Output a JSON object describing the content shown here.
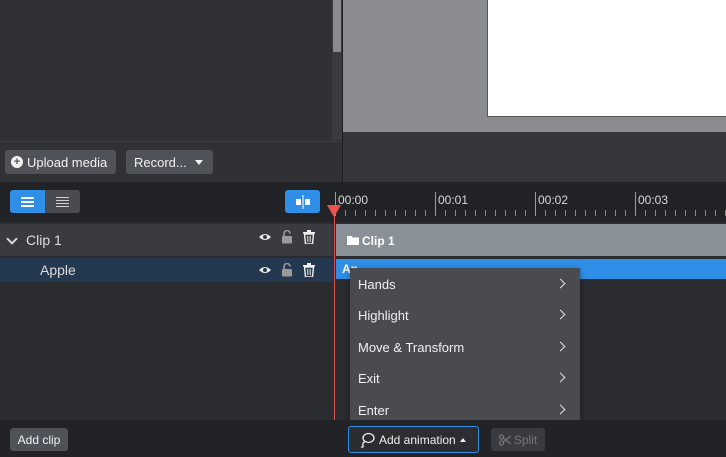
{
  "media_panel": {
    "upload_label": "Upload media",
    "record_label": "Record..."
  },
  "timeline": {
    "ruler_labels": [
      "00:00",
      "00:01",
      "00:02",
      "00:03"
    ],
    "tracks": {
      "clip_label": "Clip 1",
      "apple_label": "Apple",
      "clip_bar_label": "Clip 1",
      "apple_bar_label": "Ap"
    }
  },
  "animation_menu": {
    "items": [
      "Hands",
      "Highlight",
      "Move & Transform",
      "Exit",
      "Enter"
    ]
  },
  "bottom_bar": {
    "add_clip_label": "Add clip",
    "add_animation_label": "Add animation",
    "split_label": "Split"
  },
  "colors": {
    "accent": "#2f8fe6",
    "playhead": "#ef5350",
    "clip_bar": "#8a9097"
  }
}
